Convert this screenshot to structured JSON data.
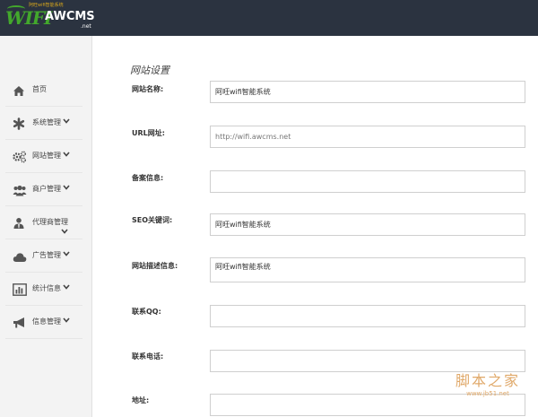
{
  "brand": {
    "logo_text": "WIFI",
    "logo_name": "AWCMS",
    "logo_tagline": "阿旺wifi智能系统",
    "logo_suffix": ".net"
  },
  "sidebar": {
    "items": [
      {
        "label": "首页",
        "icon": "home-icon",
        "chevron": false
      },
      {
        "label": "系统管理",
        "icon": "asterisk-icon",
        "chevron": true
      },
      {
        "label": "网站管理",
        "icon": "gears-icon",
        "chevron": true
      },
      {
        "label": "商户管理",
        "icon": "users-icon",
        "chevron": true
      },
      {
        "label": "代理商管理",
        "icon": "user-tie-icon",
        "chevron": true
      },
      {
        "label": "广告管理",
        "icon": "cloud-icon",
        "chevron": true
      },
      {
        "label": "统计信息",
        "icon": "bar-chart-icon",
        "chevron": true
      },
      {
        "label": "信息管理",
        "icon": "megaphone-icon",
        "chevron": true
      }
    ]
  },
  "main": {
    "section_title": "网站设置",
    "fields": [
      {
        "label": "网站名称:",
        "value": "阿旺wifi智能系统"
      },
      {
        "label": "URL网址:",
        "value": "http://wifi.awcms.net"
      },
      {
        "label": "备案信息:",
        "value": ""
      },
      {
        "label": "SEO关键词:",
        "value": "阿旺wifi智能系统"
      },
      {
        "label": "网站描述信息:",
        "value": "阿旺wifi智能系统"
      },
      {
        "label": "联系QQ:",
        "value": ""
      },
      {
        "label": "联系电话:",
        "value": ""
      },
      {
        "label": "地址:",
        "value": ""
      }
    ]
  },
  "watermark": {
    "line1": "脚本之家",
    "line2": "www.jb51.net"
  },
  "colors": {
    "header_bg": "#2b3340",
    "sidebar_bg": "#f3f3f3",
    "brand_green": "#43a82c"
  }
}
